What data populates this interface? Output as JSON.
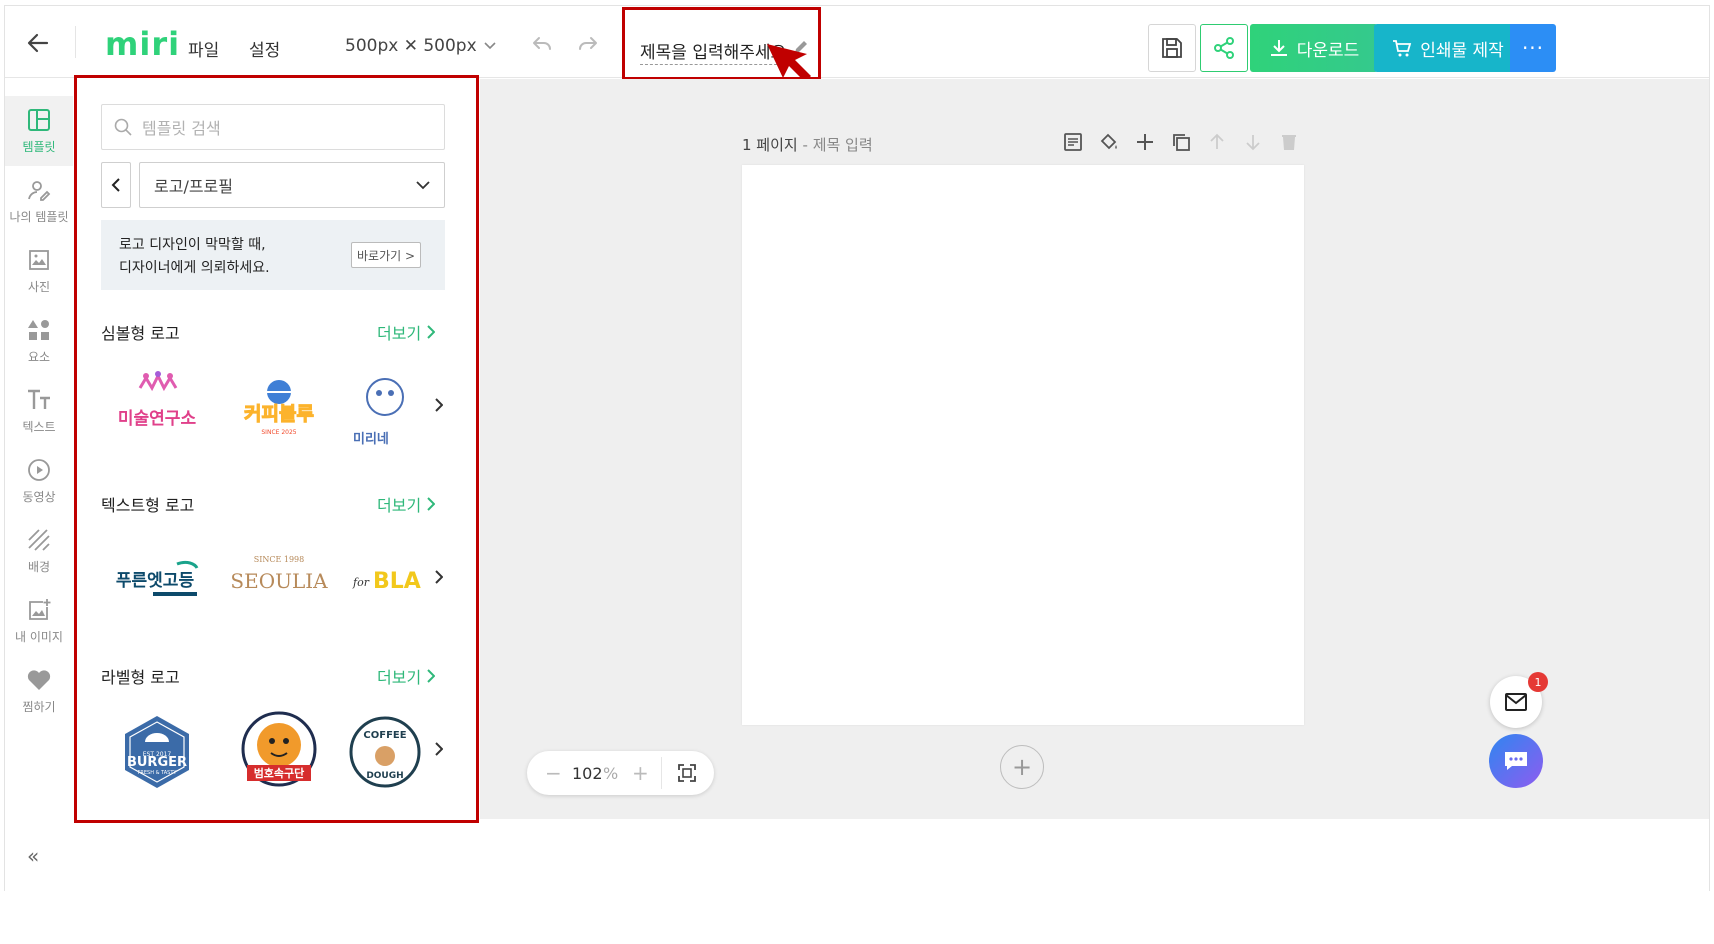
{
  "header": {
    "logo": "miri",
    "menu": [
      "파일",
      "설정"
    ],
    "size_label": "500px ✕ 500px",
    "title_placeholder": "제목을 입력해주세요.",
    "download_label": "다운로드",
    "print_label": "인쇄물 제작",
    "more_label": "···"
  },
  "rail": {
    "items": [
      {
        "label": "템플릿",
        "icon": "layout-icon"
      },
      {
        "label": "나의 템플릿",
        "icon": "user-edit-icon"
      },
      {
        "label": "사진",
        "icon": "image-icon"
      },
      {
        "label": "요소",
        "icon": "shapes-icon"
      },
      {
        "label": "텍스트",
        "icon": "text-icon"
      },
      {
        "label": "동영상",
        "icon": "play-icon"
      },
      {
        "label": "배경",
        "icon": "pattern-icon"
      },
      {
        "label": "내 이미지",
        "icon": "image-plus-icon"
      },
      {
        "label": "찜하기",
        "icon": "heart-icon"
      }
    ],
    "collapse": "«"
  },
  "panel": {
    "search_placeholder": "템플릿 검색",
    "category": "로고/프로필",
    "banner_line1": "로고 디자인이 막막할 때,",
    "banner_line2": "디자이너에게 의뢰하세요.",
    "banner_button": "바로가기 >",
    "more": "더보기",
    "sections": [
      {
        "title": "심볼형 로고",
        "thumbs": [
          "미술연구소",
          "커피블루",
          "미리네"
        ]
      },
      {
        "title": "텍스트형 로고",
        "thumbs": [
          "푸른엣고등",
          "SEOULIA",
          "BLA"
        ]
      },
      {
        "title": "라벨형 로고",
        "thumbs": [
          "BURGER",
          "범호속구단",
          "COFFEE"
        ]
      }
    ],
    "thumb_sub": {
      "burger_top": "EST   2017",
      "burger_bottom": "FRESH & TASTY",
      "seoulia_top": "SINCE 1998",
      "coffee_top": "SINCE 2025"
    }
  },
  "canvas": {
    "page_number": "1 페이지",
    "page_title": "제목 입력",
    "zoom_value": "102",
    "zoom_unit": "%"
  },
  "notifications": {
    "mail_count": "1"
  },
  "colors": {
    "accent": "#2fd27a",
    "annotation": "#c00000",
    "print": "#17b5ca",
    "more": "#2c8ef5"
  }
}
